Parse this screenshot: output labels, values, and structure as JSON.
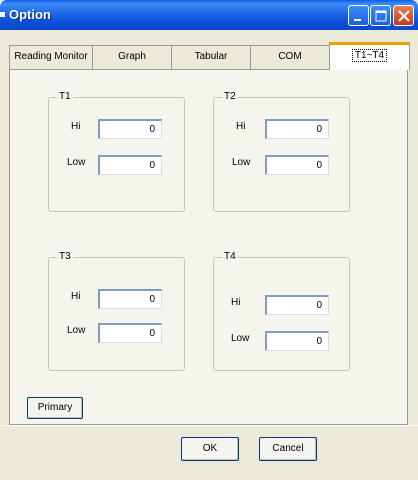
{
  "window": {
    "title": "Option"
  },
  "tabs": [
    {
      "label": "Reading Monitor"
    },
    {
      "label": "Graph"
    },
    {
      "label": "Tabular"
    },
    {
      "label": "COM"
    },
    {
      "label": "T1~T4",
      "active": true
    }
  ],
  "groups": [
    {
      "title": "T1",
      "hi_label": "Hi",
      "hi_value": "0",
      "low_label": "Low",
      "low_value": "0"
    },
    {
      "title": "T2",
      "hi_label": "Hi",
      "hi_value": "0",
      "low_label": "Low",
      "low_value": "0"
    },
    {
      "title": "T3",
      "hi_label": "Hi",
      "hi_value": "0",
      "low_label": "Low",
      "low_value": "0"
    },
    {
      "title": "T4",
      "hi_label": "Hi",
      "hi_value": "0",
      "low_label": "Low",
      "low_value": "0"
    }
  ],
  "buttons": {
    "primary": "Primary",
    "ok": "OK",
    "cancel": "Cancel"
  },
  "colors": {
    "titlebar": "#0b57da",
    "active_tab_accent": "#e8a200",
    "dialog_bg": "#ece9d8"
  },
  "icons": {
    "minimize": "minimize-icon",
    "maximize": "maximize-icon",
    "close": "close-icon"
  }
}
